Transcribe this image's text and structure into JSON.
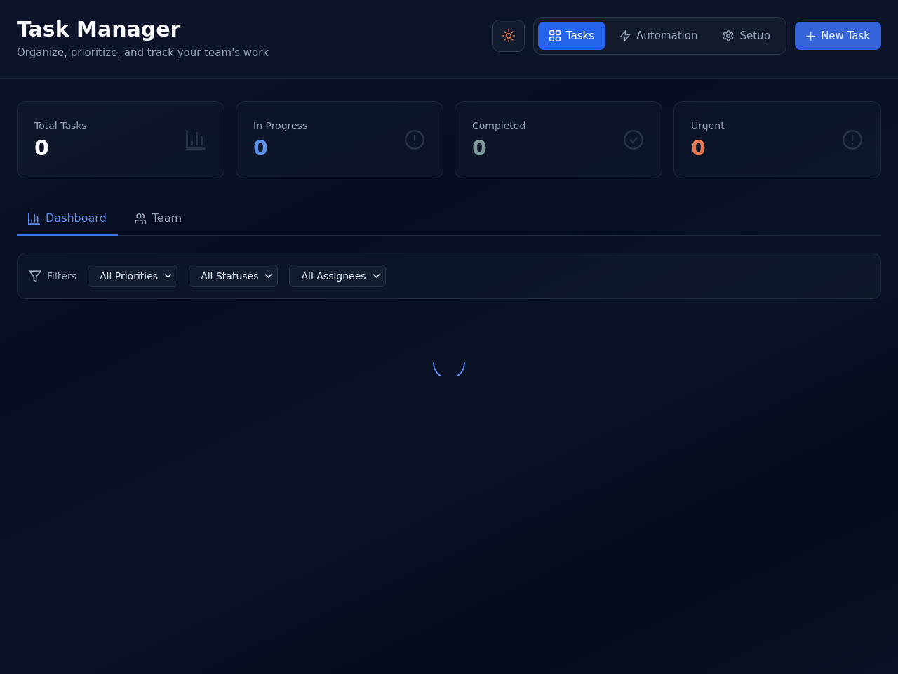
{
  "header": {
    "title": "Task Manager",
    "subtitle": "Organize, prioritize, and track your team's work"
  },
  "nav": [
    {
      "label": "Tasks",
      "selected": true
    },
    {
      "label": "Automation",
      "selected": false
    },
    {
      "label": "Setup",
      "selected": false
    }
  ],
  "new_task_button": {
    "label": "New Task"
  },
  "stats": [
    {
      "label": "Total Tasks",
      "value": "0",
      "color": "#f8fafc"
    },
    {
      "label": "In Progress",
      "value": "0",
      "color": "#5b93ef"
    },
    {
      "label": "Completed",
      "value": "0",
      "color": "#7f9c9c"
    },
    {
      "label": "Urgent",
      "value": "0",
      "color": "#ee7850"
    }
  ],
  "tabs": [
    {
      "label": "Dashboard",
      "selected": true
    },
    {
      "label": "Team",
      "selected": false
    }
  ],
  "filters": {
    "label": "Filters",
    "selects": [
      {
        "value": "All Priorities"
      },
      {
        "value": "All Statuses"
      },
      {
        "value": "All Assignees"
      }
    ]
  },
  "content": {
    "loading": true
  }
}
